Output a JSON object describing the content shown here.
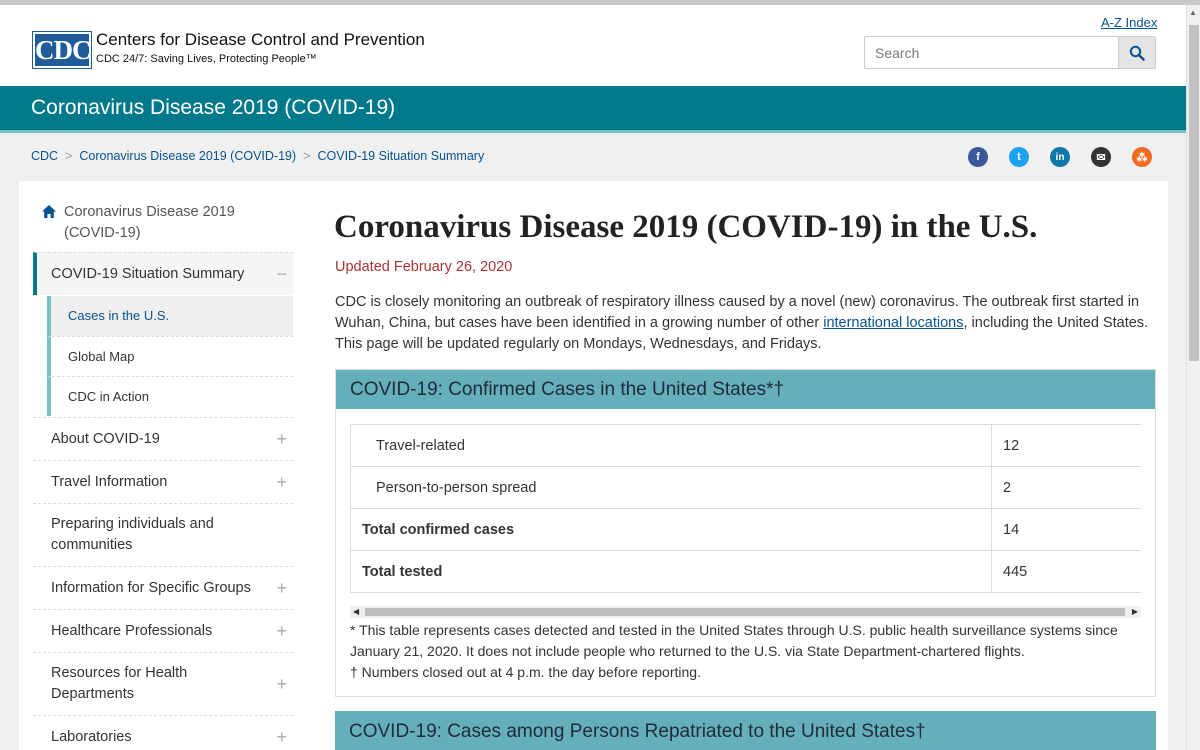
{
  "header": {
    "logo_text": "CDC",
    "org_name": "Centers for Disease Control and Prevention",
    "org_tagline": "CDC 24/7: Saving Lives, Protecting People™",
    "az_index": "A-Z Index",
    "search_placeholder": "Search",
    "search_icon": "magnifier-icon"
  },
  "band": {
    "title": "Coronavirus Disease 2019 (COVID-19)"
  },
  "breadcrumb": {
    "items": [
      "CDC",
      "Coronavirus Disease 2019 (COVID-19)",
      "COVID-19 Situation Summary"
    ],
    "separator": ">"
  },
  "social": [
    {
      "icon": "facebook-icon",
      "glyph": "f",
      "color": "#3b5998"
    },
    {
      "icon": "twitter-icon",
      "glyph": "t",
      "color": "#1da1f2"
    },
    {
      "icon": "linkedin-icon",
      "glyph": "in",
      "color": "#0e76a8"
    },
    {
      "icon": "email-icon",
      "glyph": "✉",
      "color": "#333333"
    },
    {
      "icon": "syndicate-icon",
      "glyph": "⁂",
      "color": "#f26b21"
    }
  ],
  "sidebar": {
    "home_label": "Coronavirus Disease 2019 (COVID-19)",
    "section_label": "COVID-19 Situation Summary",
    "sub_items": [
      "Cases in the U.S.",
      "Global Map",
      "CDC in Action"
    ],
    "items": [
      "About COVID-19",
      "Travel Information",
      "Preparing individuals and communities",
      "Information for Specific Groups",
      "Healthcare Professionals",
      "Resources for Health Departments",
      "Laboratories"
    ],
    "collapse_symbol": "−",
    "expand_symbol": "+"
  },
  "main": {
    "title": "Coronavirus Disease 2019 (COVID-19) in the U.S.",
    "updated": "Updated February 26, 2020",
    "intro_before": "CDC is closely monitoring an outbreak of respiratory illness caused by a novel (new) coronavirus. The outbreak first started in Wuhan, China, but cases have been identified in a growing number of other ",
    "intro_link": "international locations",
    "intro_after": ", including the United States. This page will be updated regularly on Mondays, Wednesdays, and Fridays.",
    "panel_title": "COVID-19: Confirmed Cases in the United States*†",
    "table": [
      {
        "label": "Travel-related",
        "value": "12"
      },
      {
        "label": "Person-to-person spread",
        "value": "2"
      },
      {
        "label": "Total confirmed cases",
        "value": "14"
      },
      {
        "label": "Total tested",
        "value": "445"
      }
    ],
    "footnote_1": "* This table represents cases detected and tested in the United States through U.S. public health surveillance systems since January 21, 2020. It does not include people who returned to the U.S. via State Department-chartered flights.",
    "footnote_2": "† Numbers closed out at 4 p.m. the day before reporting.",
    "panel2_title": "COVID-19: Cases among Persons Repatriated to the United States†"
  }
}
